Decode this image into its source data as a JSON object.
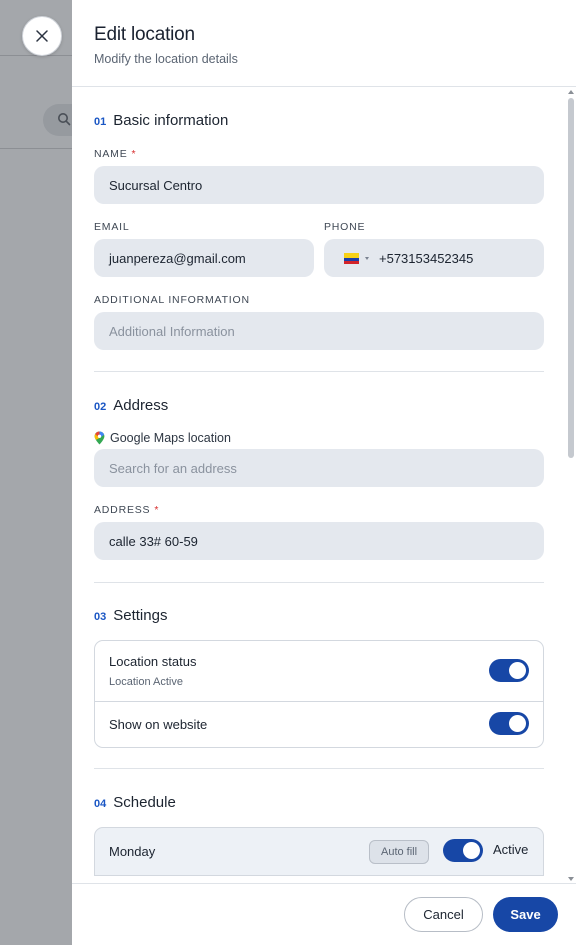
{
  "header": {
    "title": "Edit location",
    "subtitle": "Modify the location details"
  },
  "sections": {
    "basic": {
      "number": "01",
      "title": "Basic information",
      "name_label": "NAME",
      "name_required": "*",
      "name_value": "Sucursal Centro",
      "email_label": "EMAIL",
      "email_value": "juanpereza@gmail.com",
      "phone_label": "PHONE",
      "phone_value": "+573153452345",
      "phone_country_icon": "colombia-flag-icon",
      "additional_label": "ADDITIONAL INFORMATION",
      "additional_placeholder": "Additional Information"
    },
    "address": {
      "number": "02",
      "title": "Address",
      "maps_label": "Google Maps location",
      "maps_icon": "google-maps-pin-icon",
      "search_placeholder": "Search for an address",
      "address_label": "ADDRESS",
      "address_required": "*",
      "address_value": "calle 33# 60-59"
    },
    "settings": {
      "number": "03",
      "title": "Settings",
      "status_title": "Location status",
      "status_sub": "Location Active",
      "status_on": true,
      "website_title": "Show on website",
      "website_on": true
    },
    "schedule": {
      "number": "04",
      "title": "Schedule",
      "rows": [
        {
          "day": "Monday",
          "autofill_label": "Auto fill",
          "active": true,
          "active_label": "Active"
        }
      ]
    }
  },
  "footer": {
    "cancel_label": "Cancel",
    "save_label": "Save"
  },
  "colors": {
    "accent": "#1747a6",
    "required": "#d62b2b",
    "field_bg": "#e4e8ee"
  }
}
